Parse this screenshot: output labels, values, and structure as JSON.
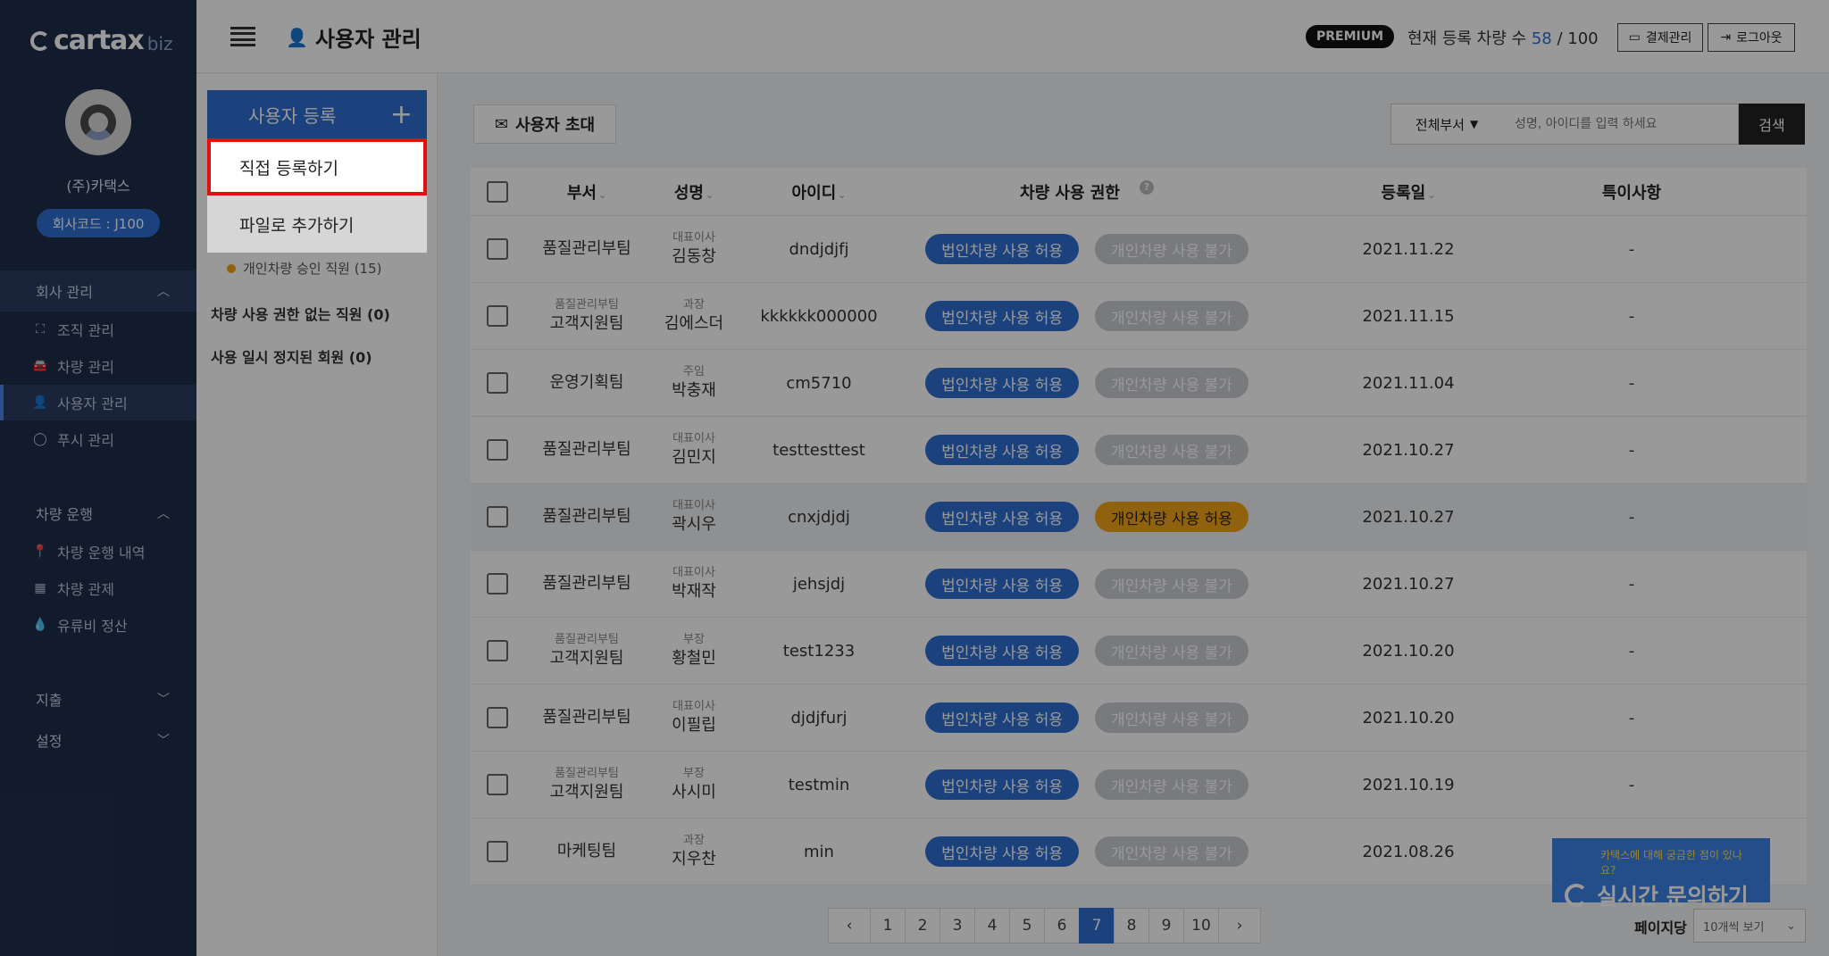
{
  "sidebar": {
    "logo_word": "cartax",
    "logo_suffix": "biz",
    "company_name": "(주)카택스",
    "company_code": "회사코드 : J100",
    "sections": [
      {
        "label": "회사 관리",
        "chevron": "chevron-up-icon"
      },
      {
        "label": "차량 운행",
        "chevron": "chevron-up-icon"
      },
      {
        "label": "지출",
        "chevron": "chevron-down-icon"
      },
      {
        "label": "설정",
        "chevron": "chevron-down-icon"
      }
    ],
    "company_items": [
      {
        "label": "조직 관리",
        "icon": "org-chart-icon"
      },
      {
        "label": "차량 관리",
        "icon": "car-icon"
      },
      {
        "label": "사용자 관리",
        "icon": "user-add-icon"
      },
      {
        "label": "푸시 관리",
        "icon": "chat-bubble-icon"
      }
    ],
    "drive_items": [
      {
        "label": "차량 운행 내역",
        "icon": "location-pin-icon"
      },
      {
        "label": "차량 관제",
        "icon": "map-icon"
      },
      {
        "label": "유류비 정산",
        "icon": "fuel-drop-icon"
      }
    ]
  },
  "header": {
    "title": "사용자 관리",
    "badge": "PREMIUM",
    "reg_label": "현재 등록 차량 수",
    "reg_current": "58",
    "reg_sep": " / ",
    "reg_max": "100",
    "billing_btn": "결제관리",
    "logout_btn": "로그아웃"
  },
  "subpanel": {
    "register_btn": "사용자 등록",
    "dropdown": [
      "직접 등록하기",
      "파일로 추가하기"
    ],
    "filter_sub": "개인차량 승인 직원 (15)",
    "filter_no_perm": "차량 사용 권한 없는 직원 (0)",
    "filter_paused": "사용 일시 정지된 회원 (0)"
  },
  "toolbar": {
    "invite_btn": "사용자 초대",
    "dept_select": "전체부서",
    "search_placeholder": "성명, 아이디를 입력 하세요",
    "search_btn": "검색"
  },
  "table": {
    "headers": {
      "dept": "부서",
      "name": "성명",
      "id": "아이디",
      "perm": "차량 사용 권한",
      "date": "등록일",
      "note": "특이사항"
    },
    "rows": [
      {
        "dept_top": "",
        "dept": "품질관리부팀",
        "title": "대표이사",
        "name": "김동창",
        "id": "dndjdjfj",
        "corp": "법인차량 사용 허용",
        "personal": "개인차량 사용 불가",
        "personal_state": "grey",
        "date": "2021.11.22",
        "note": "-"
      },
      {
        "dept_top": "품질관리부팀",
        "dept": "고객지원팀",
        "title": "과장",
        "name": "김에스더",
        "id": "kkkkkk000000",
        "corp": "법인차량 사용 허용",
        "personal": "개인차량 사용 불가",
        "personal_state": "grey",
        "date": "2021.11.15",
        "note": "-"
      },
      {
        "dept_top": "",
        "dept": "운영기획팀",
        "title": "주임",
        "name": "박충재",
        "id": "cm5710",
        "corp": "법인차량 사용 허용",
        "personal": "개인차량 사용 불가",
        "personal_state": "grey",
        "date": "2021.11.04",
        "note": "-"
      },
      {
        "dept_top": "",
        "dept": "품질관리부팀",
        "title": "대표이사",
        "name": "김민지",
        "id": "testtesttest",
        "corp": "법인차량 사용 허용",
        "personal": "개인차량 사용 불가",
        "personal_state": "grey",
        "date": "2021.10.27",
        "note": "-"
      },
      {
        "dept_top": "",
        "dept": "품질관리부팀",
        "title": "대표이사",
        "name": "곽시우",
        "id": "cnxjdjdj",
        "corp": "법인차량 사용 허용",
        "personal": "개인차량 사용 허용",
        "personal_state": "orange",
        "date": "2021.10.27",
        "note": "-"
      },
      {
        "dept_top": "",
        "dept": "품질관리부팀",
        "title": "대표이사",
        "name": "박재작",
        "id": "jehsjdj",
        "corp": "법인차량 사용 허용",
        "personal": "개인차량 사용 불가",
        "personal_state": "grey",
        "date": "2021.10.27",
        "note": "-"
      },
      {
        "dept_top": "품질관리부팀",
        "dept": "고객지원팀",
        "title": "부장",
        "name": "황철민",
        "id": "test1233",
        "corp": "법인차량 사용 허용",
        "personal": "개인차량 사용 불가",
        "personal_state": "grey",
        "date": "2021.10.20",
        "note": "-"
      },
      {
        "dept_top": "",
        "dept": "품질관리부팀",
        "title": "대표이사",
        "name": "이필립",
        "id": "djdjfurj",
        "corp": "법인차량 사용 허용",
        "personal": "개인차량 사용 불가",
        "personal_state": "grey",
        "date": "2021.10.20",
        "note": "-"
      },
      {
        "dept_top": "품질관리부팀",
        "dept": "고객지원팀",
        "title": "부장",
        "name": "사시미",
        "id": "testmin",
        "corp": "법인차량 사용 허용",
        "personal": "개인차량 사용 불가",
        "personal_state": "grey",
        "date": "2021.10.19",
        "note": "-"
      },
      {
        "dept_top": "",
        "dept": "마케팅팀",
        "title": "과장",
        "name": "지우찬",
        "id": "min",
        "corp": "법인차량 사용 허용",
        "personal": "개인차량 사용 불가",
        "personal_state": "grey",
        "date": "2021.08.26",
        "note": ""
      }
    ]
  },
  "pagination": {
    "prev": "‹",
    "next": "›",
    "pages": [
      "1",
      "2",
      "3",
      "4",
      "5",
      "6",
      "7",
      "8",
      "9",
      "10"
    ],
    "current": "7",
    "perpage_label": "페이지당",
    "perpage_value": "10개씩 보기"
  },
  "chat": {
    "question": "카택스에 대해 궁금한 점이 있나요?",
    "cta": "실시간 문의하기"
  },
  "colors": {
    "accent": "#2f6fd0",
    "sidebar": "#1f2d4a",
    "highlight_outline": "#e01010",
    "personal_allowed": "#f0a316"
  }
}
